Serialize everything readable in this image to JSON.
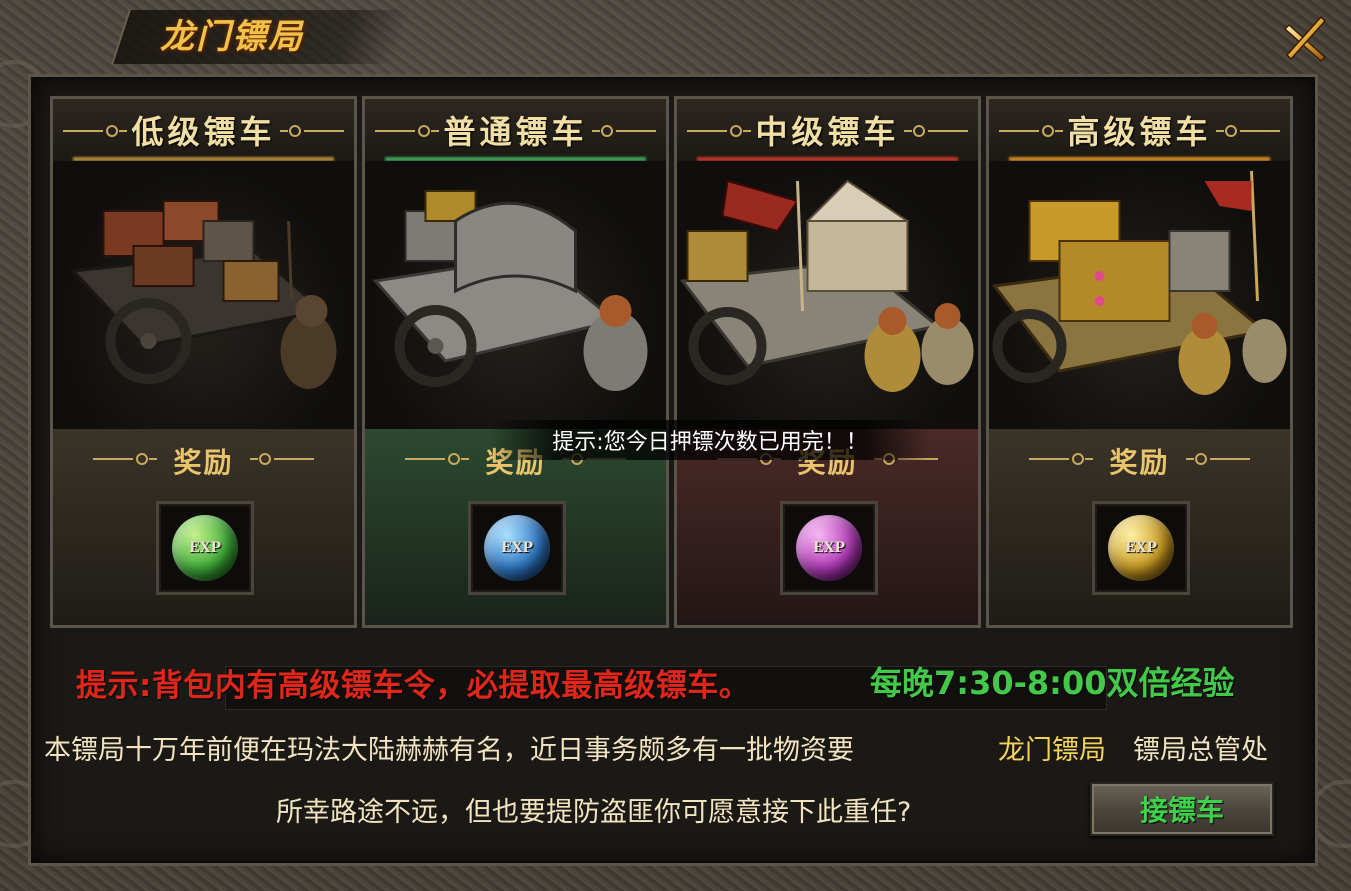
{
  "window": {
    "title": "龙门镖局"
  },
  "cards": [
    {
      "title": "低级镖车",
      "reward_label": "奖励",
      "reward_icon": "exp-orb-green",
      "orb_text": "EXP",
      "orb_color": "#3fae3a",
      "accent": "#b08a3a"
    },
    {
      "title": "普通镖车",
      "reward_label": "奖励",
      "reward_icon": "exp-orb-blue",
      "orb_text": "EXP",
      "orb_color": "#2f78c4",
      "accent": "#3fa25a"
    },
    {
      "title": "中级镖车",
      "reward_label": "奖励",
      "reward_icon": "exp-orb-purple",
      "orb_text": "EXP",
      "orb_color": "#b23ab8",
      "accent": "#c2362a"
    },
    {
      "title": "高级镖车",
      "reward_label": "奖励",
      "reward_icon": "exp-orb-gold",
      "orb_text": "EXP",
      "orb_color": "#c79a22",
      "accent": "#d28a22"
    }
  ],
  "toast": {
    "text": "提示:您今日押镖次数已用完！！"
  },
  "info": {
    "hint_red": "提示:背包内有高级镖车令，必提取最高级镖车。",
    "hint_green": "每晚7:30-8:00双倍经验",
    "desc_line1": "本镖局十万年前便在玛法大陆赫赫有名，近日事务颇多有一批物资要",
    "npc_name": "龙门镖局",
    "npc_role": "镖局总管处",
    "desc_line2": "所幸路途不远，但也要提防盗匪你可愿意接下此重任?"
  },
  "actions": {
    "accept_label": "接镖车"
  },
  "colors": {
    "hint_red": "#e0261b",
    "hint_green": "#43c84a",
    "title_gold": "#f3c04a",
    "npc_yellow": "#f4d35a"
  }
}
